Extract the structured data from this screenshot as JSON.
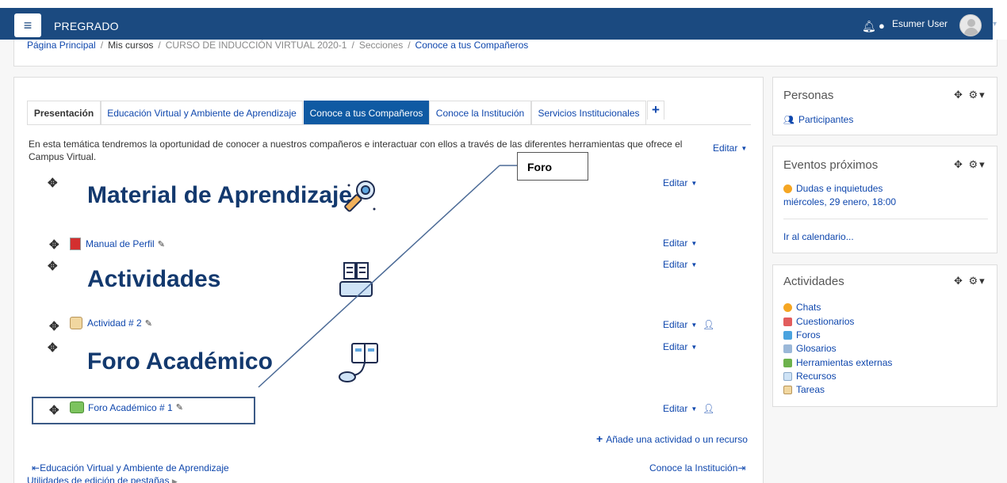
{
  "navbar": {
    "menu_icon": "hamburger-icon",
    "brand": "PREGRADO",
    "notification_icon": "bell-icon",
    "messages_icon": "chat-icon",
    "user_name": "Esumer User"
  },
  "breadcrumb": {
    "items": [
      "Página Principal",
      "Mis cursos",
      "CURSO DE INDUCCIÓN VIRTUAL 2020-1",
      "Secciones",
      "Conoce a tus Compañeros"
    ],
    "separator": "/"
  },
  "tabs": {
    "items": [
      {
        "label": "Presentación"
      },
      {
        "label": "Educación Virtual y Ambiente de Aprendizaje"
      },
      {
        "label": "Conoce a tus Compañeros"
      },
      {
        "label": "Conoce la Institución"
      },
      {
        "label": "Servicios Institucionales"
      }
    ],
    "add": "+"
  },
  "section": {
    "summary": "En esta temática tendremos la oportunidad de conocer a nuestros compañeros e interactuar con ellos a través de las diferentes herramientas que ofrece el Campus Virtual.",
    "edit_label": "Editar",
    "heading_material": "Material de Aprendizaje",
    "activity_manual": "Manual de Perfil",
    "heading_actividades": "Actividades",
    "activity_actividad2": "Actividad # 2",
    "heading_foro": "Foro Académico",
    "activity_foro1": "Foro Académico # 1",
    "add_activity": "Añade una actividad o un recurso",
    "prev_section": "Educación Virtual y Ambiente de Aprendizaje",
    "next_section": "Conoce la Institución",
    "tab_utilities": "Utilidades de edición de pestañas"
  },
  "callout": {
    "label": "Foro"
  },
  "blocks": {
    "personas": {
      "title": "Personas",
      "item": "Participantes"
    },
    "eventos": {
      "title": "Eventos próximos",
      "event_title": "Dudas e inquietudes",
      "event_date": "miércoles, 29 enero, 18:00",
      "calendar_link": "Ir al calendario..."
    },
    "actividades": {
      "title": "Actividades",
      "items": [
        "Chats",
        "Cuestionarios",
        "Foros",
        "Glosarios",
        "Herramientas externas",
        "Recursos",
        "Tareas"
      ]
    }
  },
  "colors": {
    "navbar": "#1b4a80",
    "accent": "#0f5aa3",
    "link": "#0f47ad",
    "heading": "#13396e"
  }
}
